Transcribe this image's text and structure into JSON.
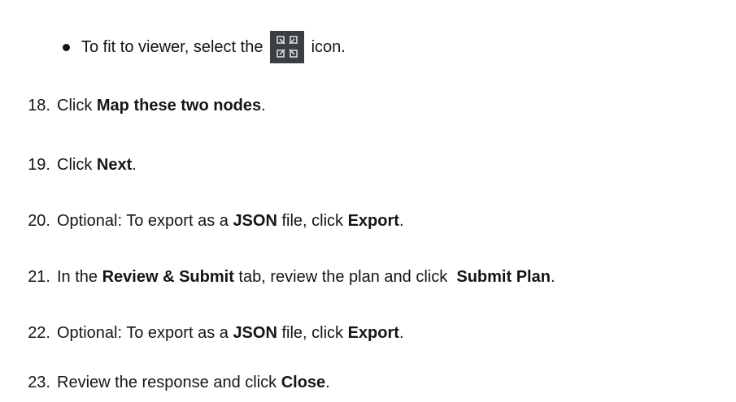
{
  "fit_bullet": {
    "before": "To fit to viewer, select the",
    "icon": "fit-to-viewer-icon",
    "after": "icon."
  },
  "steps": [
    {
      "num": "18.",
      "parts": [
        "Click ",
        "Map these two nodes",
        "."
      ]
    },
    {
      "num": "19.",
      "parts": [
        "Click ",
        "Next",
        "."
      ]
    },
    {
      "num": "20.",
      "parts": [
        "Optional: To export as a ",
        "JSON",
        " file, click ",
        "Export",
        "."
      ]
    },
    {
      "num": "21.",
      "parts": [
        "In the ",
        "Review & Submit",
        " tab, review the plan and click  ",
        "Submit Plan",
        "."
      ]
    },
    {
      "num": "22.",
      "parts": [
        "Optional: To export as a ",
        "JSON",
        " file, click ",
        "Export",
        "."
      ]
    },
    {
      "num": "23.",
      "parts": [
        "Review the response and click ",
        "Close",
        "."
      ]
    }
  ]
}
